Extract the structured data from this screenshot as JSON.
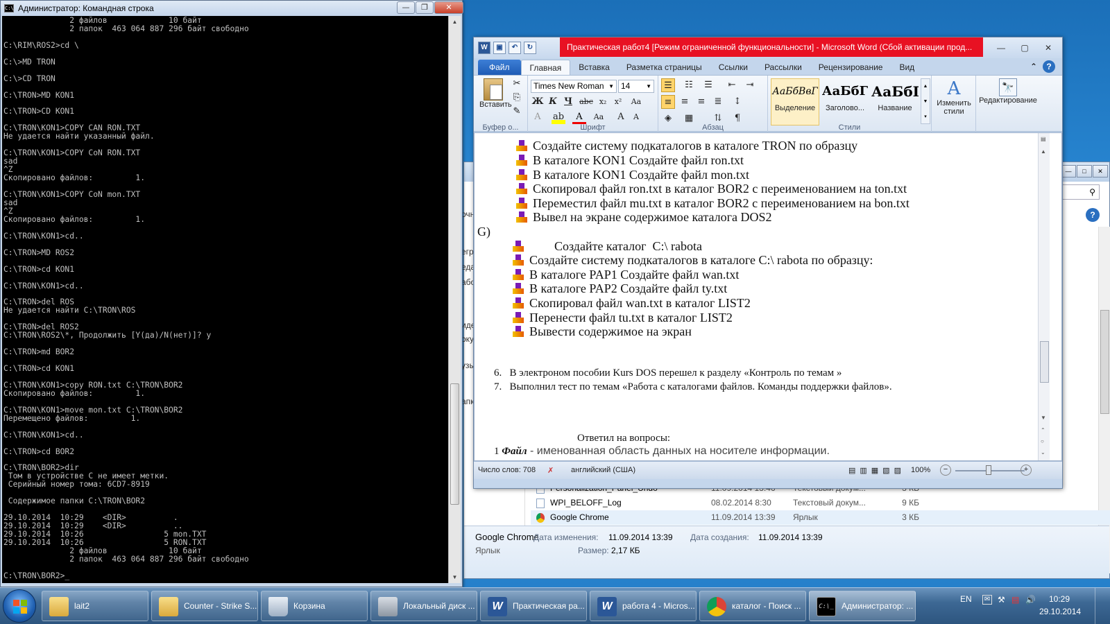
{
  "cmd": {
    "title": "Администратор: Командная строка",
    "output": "              2 файлов             10 байт\n              2 папок  463 064 887 296 байт свободно\n\nC:\\RIM\\ROS2>cd \\\n\nC:\\>MD TRON\n\nC:\\>CD TRON\n\nC:\\TRON>MD KON1\n\nC:\\TRON>CD KON1\n\nC:\\TRON\\KON1>COPY CAN RON.TXT\nНе удается найти указанный файл.\n\nC:\\TRON\\KON1>COPY CoN RON.TXT\nsad\n^Z\nСкопировано файлов:         1.\n\nC:\\TRON\\KON1>COPY CoN mon.TXT\nsad\n^Z\nСкопировано файлов:         1.\n\nC:\\TRON\\KON1>cd..\n\nC:\\TRON>MD ROS2\n\nC:\\TRON>cd KON1\n\nC:\\TRON\\KON1>cd..\n\nC:\\TRON>del ROS\nНе удается найти C:\\TRON\\ROS\n\nC:\\TRON>del ROS2\nC:\\TRON\\ROS2\\*, Продолжить [Y(да)/N(нет)]? y\n\nC:\\TRON>md BOR2\n\nC:\\TRON>cd KON1\n\nC:\\TRON\\KON1>copy RON.txt C:\\TRON\\BOR2\nСкопировано файлов:         1.\n\nC:\\TRON\\KON1>move mon.txt C:\\TRON\\BOR2\nПеремещено файлов:         1.\n\nC:\\TRON\\KON1>cd..\n\nC:\\TRON>cd BOR2\n\nC:\\TRON\\BOR2>dir\n Том в устройстве C не имеет метки.\n Серийный номер тома: 6CD7-8919\n\n Содержимое папки C:\\TRON\\BOR2\n\n29.10.2014  10:29    <DIR>          .\n29.10.2014  10:29    <DIR>          ..\n29.10.2014  10:26                 5 mon.TXT\n29.10.2014  10:26                 5 RON.TXT\n              2 файлов             10 байт\n              2 папок  463 064 887 296 байт свободно\n\nC:\\TRON\\BOR2>_"
  },
  "word": {
    "title": "Практическая работ4 [Режим ограниченной функциональности]  -  Microsoft Word (Сбой активации прод...",
    "tabs": [
      "Файл",
      "Главная",
      "Вставка",
      "Разметка страницы",
      "Ссылки",
      "Рассылки",
      "Рецензирование",
      "Вид"
    ],
    "ribbon": {
      "paste": "Вставить",
      "font_name": "Times New Roman",
      "font_size": "14",
      "groups": [
        "Буфер о...",
        "Шрифт",
        "Абзац",
        "Стили"
      ],
      "styles": [
        {
          "preview": "АаБбВвГ",
          "name": "Выделение"
        },
        {
          "preview": "АаБбГ",
          "name": "Заголово..."
        },
        {
          "preview": "АаБбГ",
          "name": "Название"
        }
      ],
      "change_styles": "Изменить стили",
      "editing": "Редактирование"
    },
    "doc": {
      "list1": [
        "Создайте систему подкаталогов в каталоге TRON  по образцу",
        "В каталоге KON1 Создайте файл ron.txt",
        "В каталоге KON1 Создайте файл mon.txt",
        "Скопировал файл ron.txt в каталог BOR2  с переименованием на ton.txt",
        "Переместил файл mu.txt в каталог BOR2 с переименованием на bon.txt",
        "Вывел на экране содержимое каталога DOS2"
      ],
      "section_g": "G)",
      "list2": [
        "        Создайте каталог  C:\\ rabota",
        "Создайте систему подкаталогов в каталоге  C:\\ rabota по образцу:",
        "В каталоге PAP1 Создайте файл wan.txt",
        "В каталоге PAP2 Создайте файл ty.txt",
        "Скопировал файл wan.txt в каталог  LIST2",
        "Перенести файл tu.txt в каталог LIST2",
        "Вывести содержимое на экран"
      ],
      "numbered": [
        {
          "n": "6.",
          "text": "В электроном пособии Kurs DOS перешел к разделу «Контроль по темам »"
        },
        {
          "n": "7.",
          "text": "Выполнил тест по темам «Работа с каталогами файлов. Команды поддержки файлов»."
        }
      ],
      "answers_heading": "Ответил на вопросы:",
      "answer_num": "1",
      "answer_term": "Файл",
      "answer_text": " - именованная область данных на носителе информации."
    },
    "status": {
      "words": "Число слов: 708",
      "lang": "английский (США)",
      "zoom": "100%",
      "zoom_level": 1.0
    }
  },
  "explorer": {
    "left_fragments": [
      "очн",
      "егр",
      "еда",
      "або",
      "иде",
      "оку",
      "узы",
      "апк"
    ],
    "files": [
      {
        "name": "Personalization_Panel_Undo",
        "date": "11.09.2014 13:46",
        "type": "Текстовый докум...",
        "size": "3 КБ",
        "icon": "text-file-icon"
      },
      {
        "name": "WPI_BELOFF_Log",
        "date": "08.02.2014 8:30",
        "type": "Текстовый докум...",
        "size": "9 КБ",
        "icon": "text-file-icon"
      },
      {
        "name": "Google Chrome",
        "date": "11.09.2014 13:39",
        "type": "Ярлык",
        "size": "3 КБ",
        "icon": "chrome-icon"
      }
    ],
    "details": {
      "name": "Google Chrome",
      "type": "Ярлык",
      "modified_label": "Дата изменения:",
      "modified": "11.09.2014 13:39",
      "created_label": "Дата создания:",
      "created": "11.09.2014 13:39",
      "size_label": "Размер:",
      "size": "2,17 КБ"
    }
  },
  "taskbar": {
    "items": [
      {
        "label": "lait2",
        "icon": "folder-icon"
      },
      {
        "label": "Counter - Strike S...",
        "icon": "folder-icon"
      },
      {
        "label": "Корзина",
        "icon": "recycle-bin-icon"
      },
      {
        "label": "Локальный диск ...",
        "icon": "drive-icon"
      },
      {
        "label": "Практическая ра...",
        "icon": "word-icon"
      },
      {
        "label": "работа 4 - Micros...",
        "icon": "word-icon"
      },
      {
        "label": "каталог - Поиск ...",
        "icon": "chrome-icon"
      },
      {
        "label": "Администратор: ...",
        "icon": "cmd-icon"
      }
    ],
    "lang": "EN",
    "time": "10:29",
    "date": "29.10.2014"
  },
  "colors": {
    "title_red": "#e81123",
    "word_blue": "#2b5797",
    "console_bg": "#000000",
    "console_fg": "#c0c0c0"
  }
}
